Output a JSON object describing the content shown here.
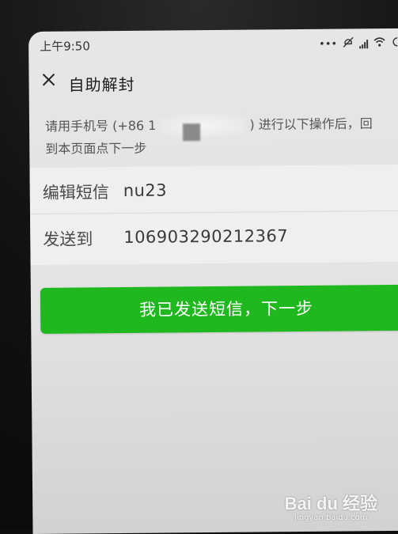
{
  "status_bar": {
    "time": "上午9:50",
    "icons": [
      "dots-icon",
      "mute-icon",
      "signal-icon",
      "wifi-icon",
      "battery-icon"
    ]
  },
  "header": {
    "close_icon": "close-icon",
    "title": "自助解封"
  },
  "instruction": {
    "prefix": "请用手机号 (+86 1",
    "suffix": ") 进行以下操作后，回",
    "line2": "到本页面点下一步"
  },
  "rows": [
    {
      "label": "编辑短信",
      "value": "nu23"
    },
    {
      "label": "发送到",
      "value": "106903290212367"
    }
  ],
  "primary_button": {
    "label": "我已发送短信，下一步"
  },
  "watermark": {
    "logo_text": "Bai du 经验",
    "subtext": "jingyan.baidu.com"
  },
  "colors": {
    "accent": "#1fb91f",
    "background": "#e6e6e6",
    "text": "#1c1c1c"
  }
}
